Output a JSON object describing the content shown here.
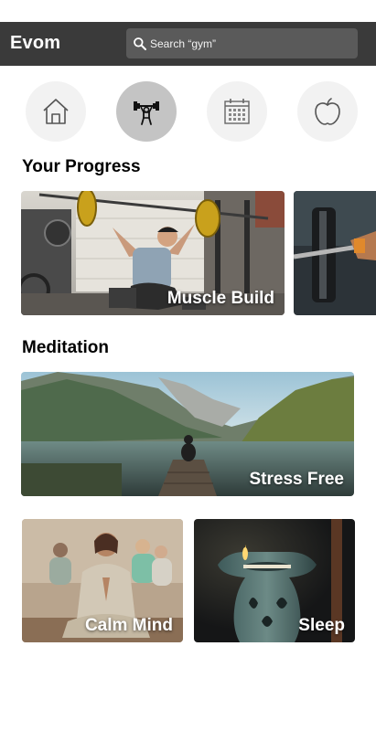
{
  "header": {
    "app_title": "Evom",
    "search": {
      "placeholder": "Search “gym”",
      "value": ""
    }
  },
  "categories": [
    {
      "icon": "home-icon",
      "active": false
    },
    {
      "icon": "dumbbell-icon",
      "active": true
    },
    {
      "icon": "calendar-icon",
      "active": false
    },
    {
      "icon": "apple-icon",
      "active": false
    }
  ],
  "progress": {
    "title": "Your Progress",
    "cards": [
      {
        "label": "Muscle Build"
      },
      {
        "label": ""
      }
    ]
  },
  "meditation": {
    "title": "Meditation",
    "cards": [
      {
        "label": "Stress Free"
      },
      {
        "label": "Calm Mind"
      },
      {
        "label": "Sleep"
      }
    ]
  },
  "colors": {
    "header_bg": "#3a3a3a",
    "search_bg": "#5a5a5a",
    "active_category": "#c4c4c4",
    "category_bg": "#f2f2f2"
  }
}
